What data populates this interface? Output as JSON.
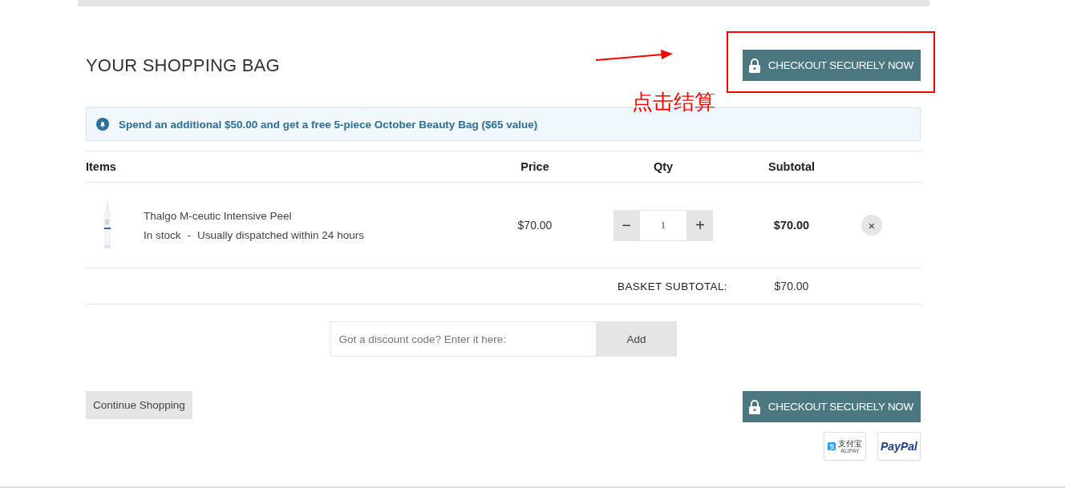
{
  "header": {
    "title": "YOUR SHOPPING BAG",
    "checkout_button": "CHECKOUT SECURELY NOW"
  },
  "annotation": {
    "label": "点击结算"
  },
  "banner": {
    "text": "Spend an additional $50.00 and get a free 5-piece October Beauty Bag ($65 value)"
  },
  "table": {
    "columns": [
      "Items",
      "Price",
      "Qty",
      "Subtotal"
    ],
    "rows": [
      {
        "name": "Thalgo M-ceutic Intensive Peel",
        "stock": "In stock",
        "separator": "-",
        "dispatch": "Usually dispatched within 24 hours",
        "price": "$70.00",
        "decrease": "−",
        "quantity": "1",
        "increase": "+",
        "remove": "×",
        "subtotal": "$70.00"
      }
    ]
  },
  "basket_subtotal": {
    "label": "BASKET SUBTOTAL:",
    "value": "$70.00"
  },
  "discount": {
    "placeholder": "Got a discount code? Enter it here:",
    "button": "Add"
  },
  "footer": {
    "continue_button": "Continue Shopping",
    "checkout_button": "CHECKOUT SECURELY NOW",
    "payment_methods": [
      {
        "kind": "alipay",
        "name": "支付宝",
        "sub": "ALIPAY"
      },
      {
        "kind": "paypal",
        "name": "PayPal"
      }
    ]
  }
}
